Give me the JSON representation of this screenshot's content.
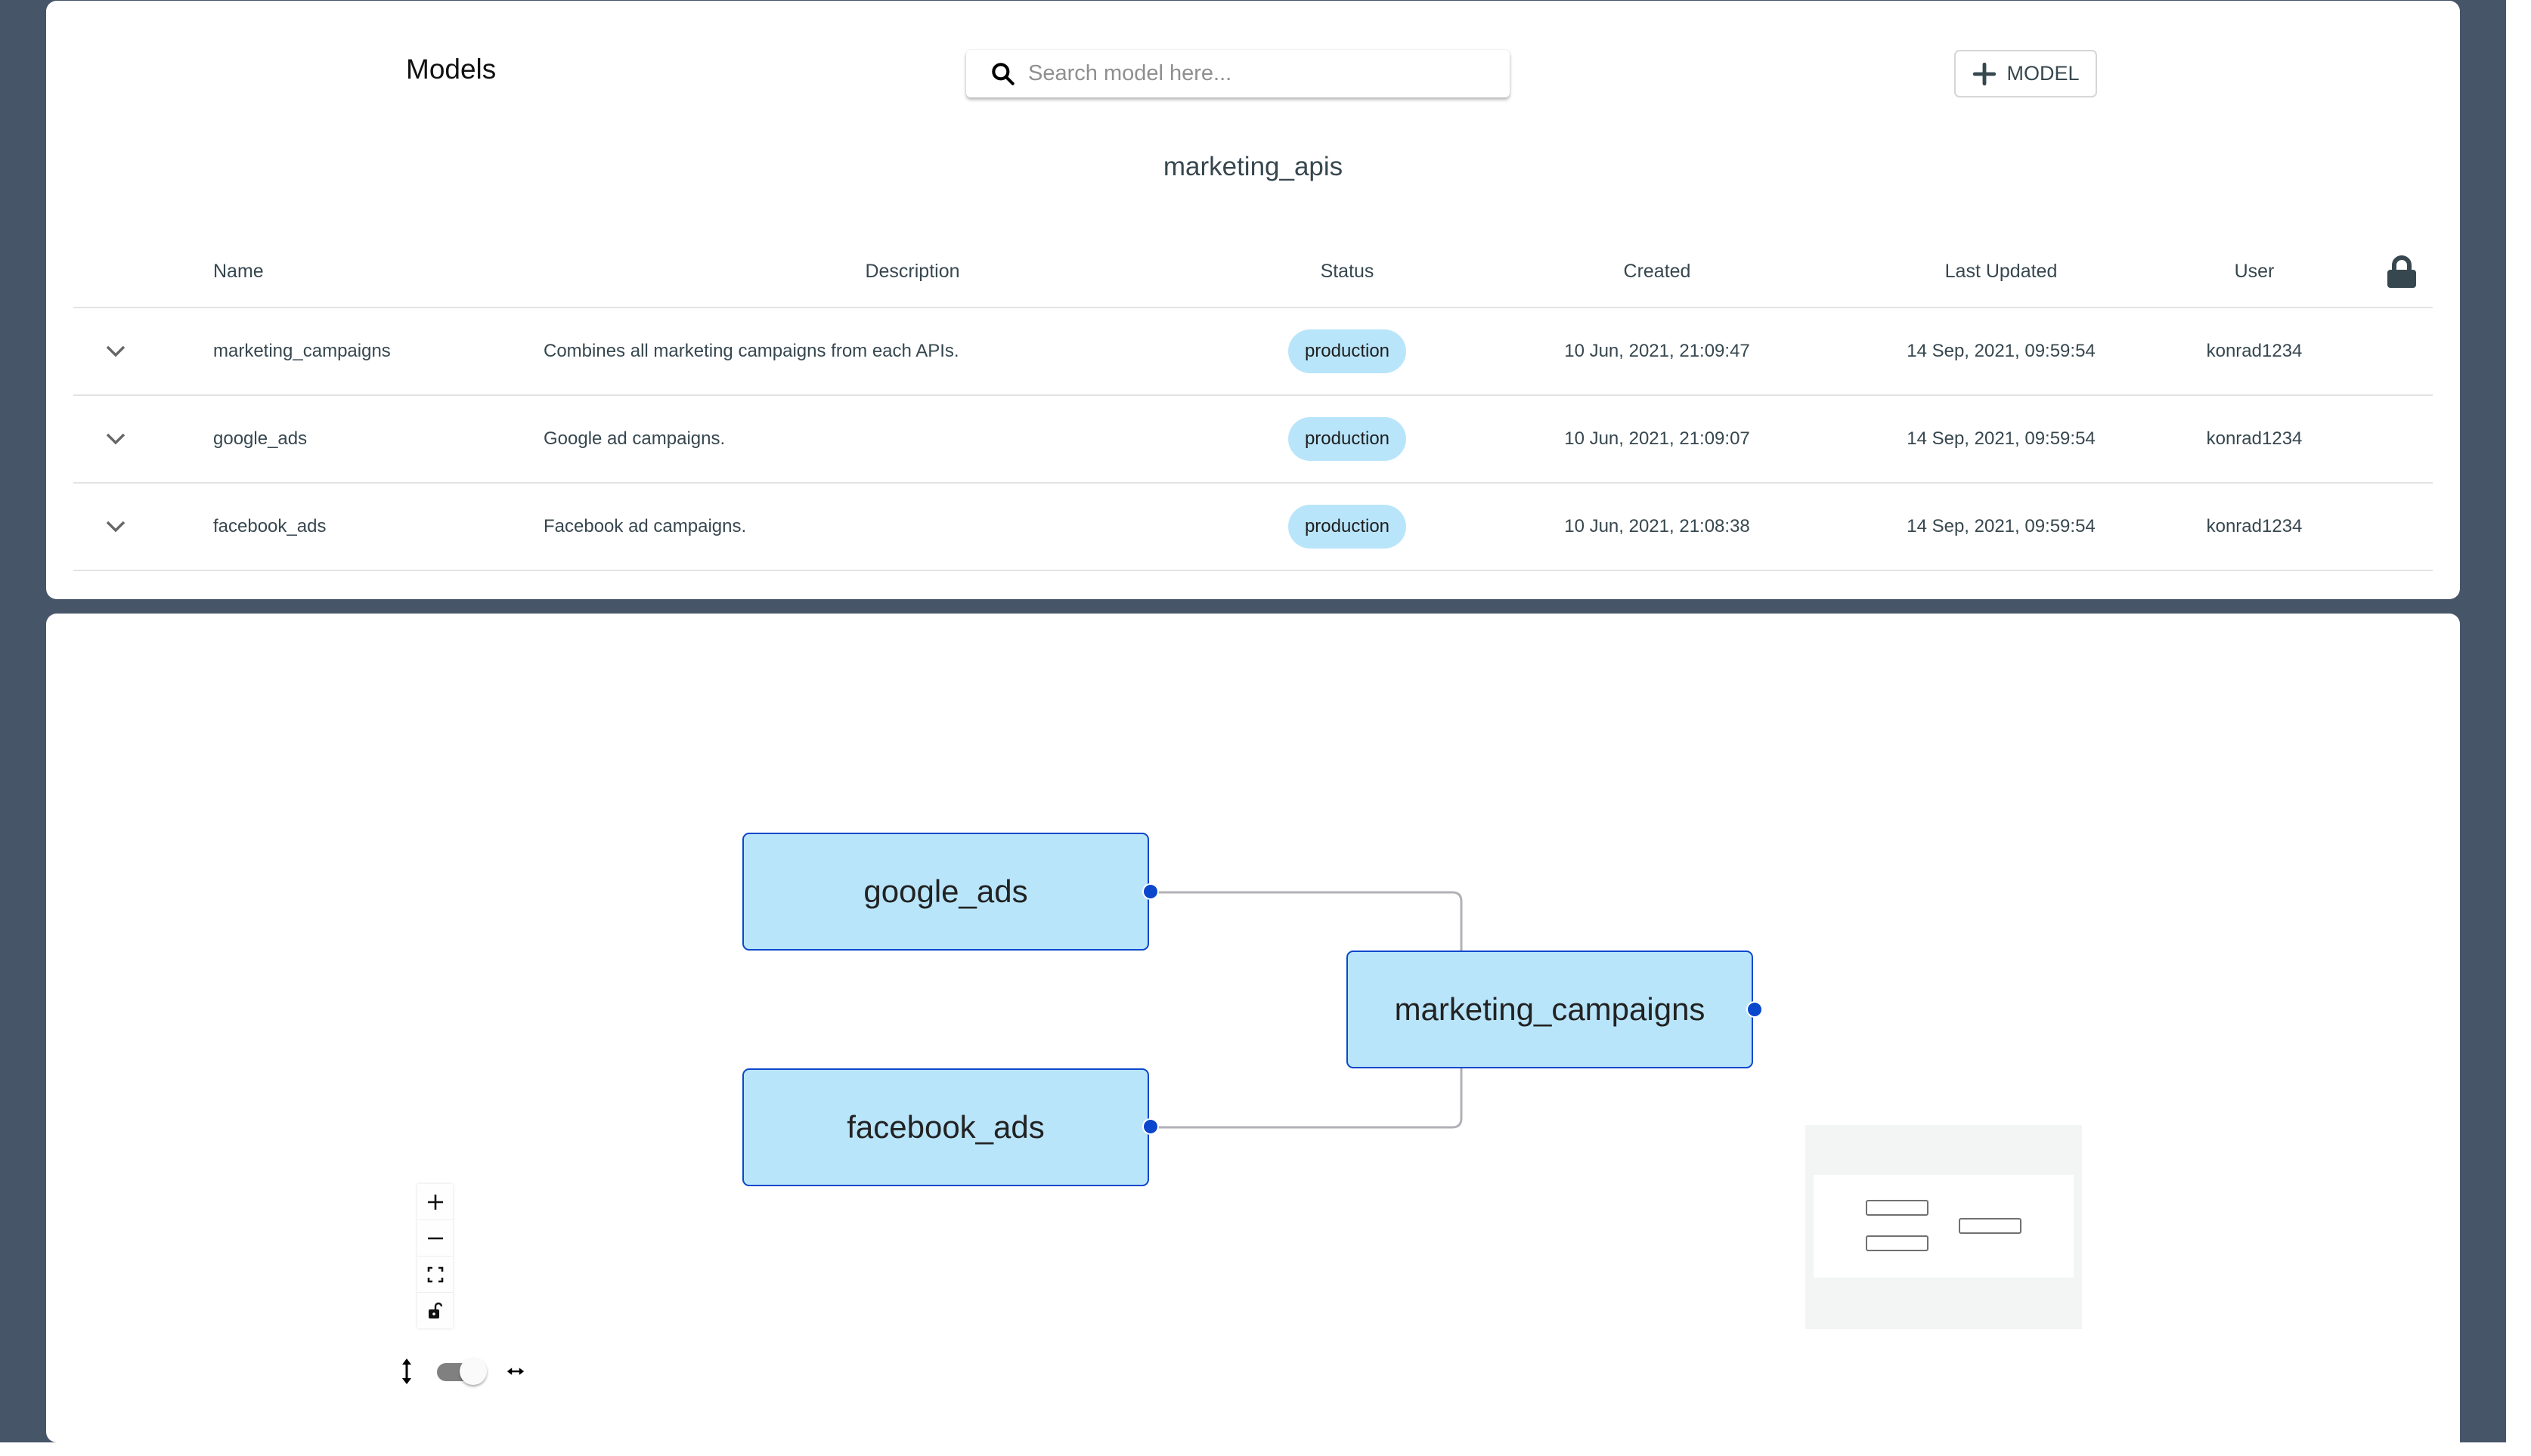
{
  "header": {
    "title": "Models",
    "search": {
      "placeholder": "Search model here...",
      "value": "",
      "icon": "search-icon"
    },
    "add_button": {
      "label": "MODEL",
      "icon": "plus-icon"
    }
  },
  "group": {
    "title": "marketing_apis"
  },
  "table": {
    "columns": [
      "Name",
      "Description",
      "Status",
      "Created",
      "Last Updated",
      "User"
    ],
    "lock_icon": "lock-icon",
    "rows": [
      {
        "name": "marketing_campaigns",
        "description": "Combines all marketing campaigns from each APIs.",
        "status": "production",
        "created": "10 Jun, 2021, 21:09:47",
        "last_updated": "14 Sep, 2021, 09:59:54",
        "user": "konrad1234"
      },
      {
        "name": "google_ads",
        "description": "Google ad campaigns.",
        "status": "production",
        "created": "10 Jun, 2021, 21:09:07",
        "last_updated": "14 Sep, 2021, 09:59:54",
        "user": "konrad1234"
      },
      {
        "name": "facebook_ads",
        "description": "Facebook ad campaigns.",
        "status": "production",
        "created": "10 Jun, 2021, 21:08:38",
        "last_updated": "14 Sep, 2021, 09:59:54",
        "user": "konrad1234"
      }
    ]
  },
  "graph": {
    "nodes": [
      {
        "id": "google_ads",
        "label": "google_ads"
      },
      {
        "id": "facebook_ads",
        "label": "facebook_ads"
      },
      {
        "id": "marketing_campaigns",
        "label": "marketing_campaigns"
      }
    ],
    "edges": [
      {
        "source": "google_ads",
        "target": "marketing_campaigns"
      },
      {
        "source": "facebook_ads",
        "target": "marketing_campaigns"
      }
    ],
    "controls": [
      "zoom-in",
      "zoom-out",
      "fit-view",
      "toggle-interactivity"
    ],
    "layout_toggle": {
      "left_icon": "vertical-arrows-icon",
      "right_icon": "horizontal-arrows-icon",
      "state": "horizontal"
    }
  },
  "colors": {
    "background": "#475569",
    "node_fill": "#b9e5fb",
    "node_border": "#0b47cc",
    "badge_fill": "#b9e5fb",
    "edge": "#b1b1b7",
    "text": "#37474f"
  }
}
